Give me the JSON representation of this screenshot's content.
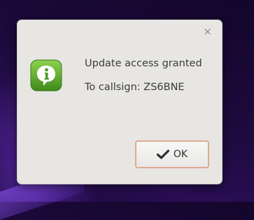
{
  "dialog": {
    "close_symbol": "×",
    "icon": "information-icon",
    "message_line1": "Update access granted",
    "message_line2": "To callsign: ZS6BNE",
    "ok_label": "OK",
    "ok_icon": "checkmark-icon"
  },
  "colors": {
    "icon_green": "#5da82a",
    "button_border": "#e0a98f",
    "dialog_bg": "#e7e6e3"
  }
}
